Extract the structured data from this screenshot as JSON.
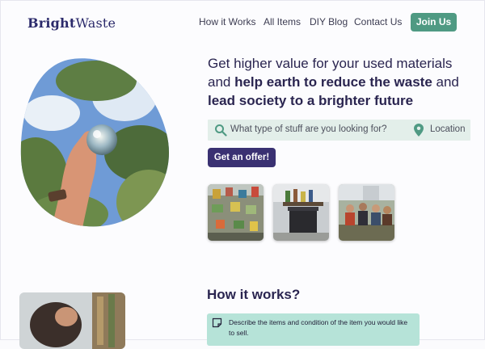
{
  "brand": {
    "name_part1": "Bright",
    "name_part2": "Waste"
  },
  "nav": {
    "items": [
      {
        "label": "How it Works"
      },
      {
        "label": "All Items"
      },
      {
        "label": "DIY Blog"
      },
      {
        "label": "Contact Us"
      }
    ],
    "join_label": "Join Us"
  },
  "hero": {
    "line1_plain": "Get higher value for your used materials",
    "line2_plain": "and ",
    "line2_bold": "help earth to reduce the waste",
    "line2_tail": " and",
    "line3_bold": "lead society to a brighter future",
    "search_placeholder": "What type of stuff are you looking for?",
    "location_label": "Location",
    "offer_label": "Get an offer!"
  },
  "how_it_works": {
    "title": "How it works?",
    "steps": [
      {
        "text": "Describe the items and condition of the item you would like to sell."
      }
    ]
  },
  "colors": {
    "accent_green": "#4f9a83",
    "primary_purple": "#3a3172",
    "search_bg": "#e3efea",
    "step_bg": "#b6e3d8"
  },
  "icons": {
    "search": "search-icon",
    "location": "location-pin-icon",
    "step": "note-icon"
  }
}
